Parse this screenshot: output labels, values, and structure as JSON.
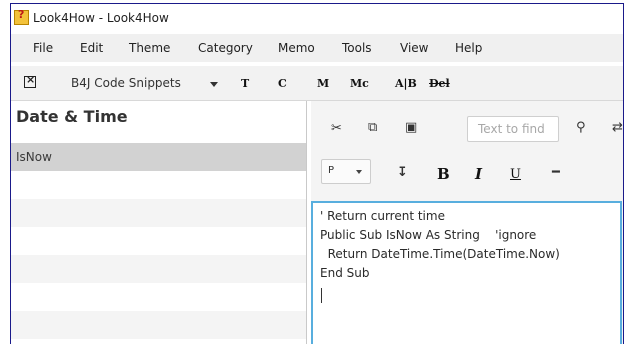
{
  "window": {
    "title": "Look4How - Look4How"
  },
  "menu": {
    "items": [
      "File",
      "Edit",
      "Theme",
      "Category",
      "Memo",
      "Tools",
      "View",
      "Help"
    ]
  },
  "toolbar": {
    "collection": "B4J Code Snippets",
    "buttons": [
      "T",
      "C",
      "M",
      "Mc",
      "A|B",
      "Del"
    ]
  },
  "sidebar": {
    "title": "Date & Time",
    "items": [
      "IsNow"
    ]
  },
  "editor_toolbar": {
    "find_placeholder": "Text to find",
    "style_value": "P",
    "format": {
      "bold": "B",
      "italic": "I",
      "underline": "U"
    }
  },
  "editor": {
    "lines": [
      "' Return current time",
      "Public Sub IsNow As String    'ignore",
      "  Return DateTime.Time(DateTime.Now)",
      "End Sub"
    ]
  }
}
